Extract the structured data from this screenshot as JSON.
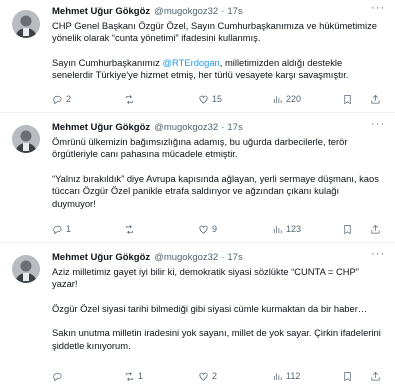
{
  "tweets": [
    {
      "name": "Mehmet Uğur Gökgöz",
      "handle": "@mugokgoz32",
      "dot": "·",
      "time": "17s",
      "more": "···",
      "p1": "CHP Genel Başkanı Özgür Özel, Sayın Cumhurbaşkanımıza ve hükümetimize yönelik olarak “cunta yönetimi” ifadesini kullanmış.",
      "p2_before": "Sayın Cumhurbaşkanımız ",
      "p2_mention": "@RTErdogan",
      "p2_after": ", milletimizden aldığı destekle senelerdir Türkiye'ye hizmet etmiş, her türlü vesayete karşı savaşmıştır.",
      "replies": "2",
      "retweets": "",
      "likes": "15",
      "views": "220"
    },
    {
      "name": "Mehmet Uğur Gökgöz",
      "handle": "@mugokgoz32",
      "dot": "·",
      "time": "17s",
      "more": "···",
      "p1": "Ömrünü ülkemizin bağımsızlığına adamış, bu uğurda darbecilerle, terör örgütleriyle canı pahasına mücadele etmiştir.",
      "p2": "“Yalnız bırakıldık” diye Avrupa kapısında ağlayan, yerli sermaye düşmanı, kaos tüccarı Özgür Özel panikle etrafa saldırıyor ve ağzından çıkanı kulağı duymuyor!",
      "replies": "1",
      "retweets": "",
      "likes": "9",
      "views": "123"
    },
    {
      "name": "Mehmet Uğur Gökgöz",
      "handle": "@mugokgoz32",
      "dot": "·",
      "time": "17s",
      "more": "···",
      "p1": "Aziz milletimiz gayet iyi bilir ki, demokratik siyasi sözlükte “CUNTA = CHP” yazar!",
      "p2": "Özgür Özel siyasi tarihi bilmediği gibi siyasi cümle kurmaktan da bir haber…",
      "p3": "Sakın unutma milletin iradesini yok sayanı, millet de yok sayar. Çirkin ifadelerini şiddetle kınıyorum.",
      "replies": "",
      "retweets": "1",
      "likes": "2",
      "views": "112"
    }
  ]
}
